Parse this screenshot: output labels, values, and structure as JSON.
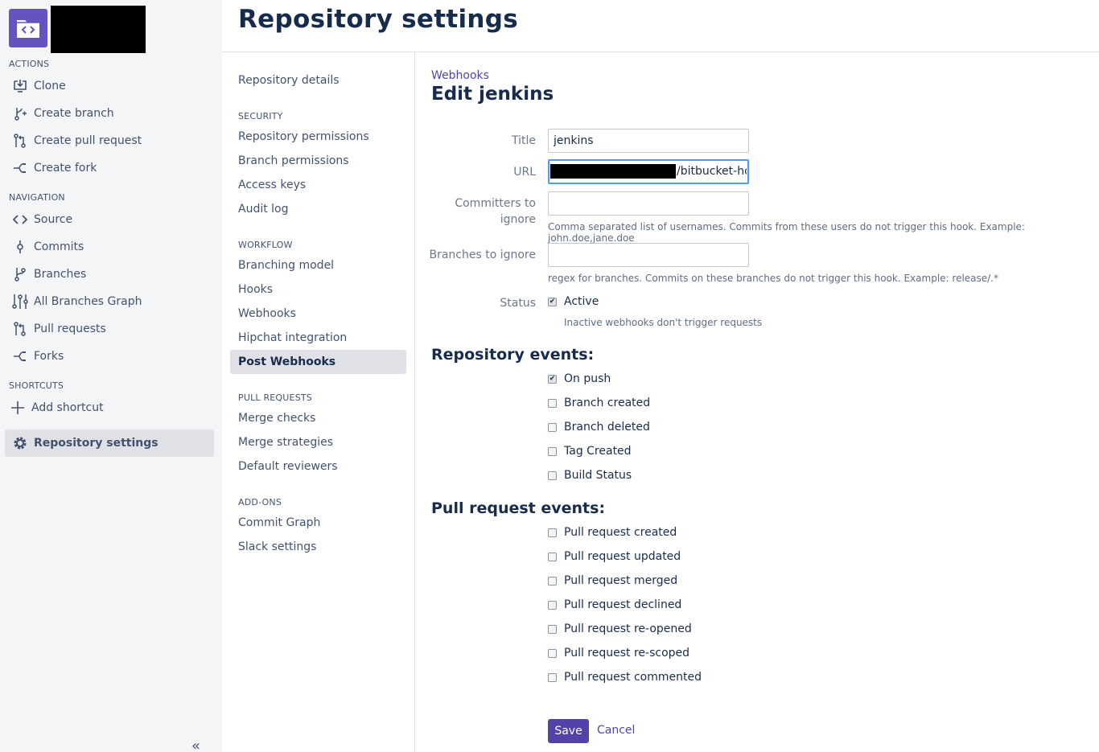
{
  "sidebar": {
    "sections": {
      "actions": "ACTIONS",
      "navigation": "NAVIGATION",
      "shortcuts": "SHORTCUTS"
    },
    "actions": [
      {
        "label": "Clone",
        "icon": "clone-icon"
      },
      {
        "label": "Create branch",
        "icon": "create-branch-icon"
      },
      {
        "label": "Create pull request",
        "icon": "create-pull-request-icon"
      },
      {
        "label": "Create fork",
        "icon": "create-fork-icon"
      }
    ],
    "navigation": [
      {
        "label": "Source",
        "icon": "source-icon"
      },
      {
        "label": "Commits",
        "icon": "commits-icon"
      },
      {
        "label": "Branches",
        "icon": "branches-icon"
      },
      {
        "label": "All Branches Graph",
        "icon": "all-branches-graph-icon"
      },
      {
        "label": "Pull requests",
        "icon": "pull-requests-icon"
      },
      {
        "label": "Forks",
        "icon": "forks-icon"
      }
    ],
    "shortcuts": [
      {
        "label": "Add shortcut",
        "icon": "plus-icon"
      }
    ],
    "settings": {
      "label": "Repository settings",
      "icon": "gear-icon"
    }
  },
  "page": {
    "title": "Repository settings"
  },
  "settings_nav": {
    "repository_details": "Repository details",
    "security": {
      "heading": "SECURITY",
      "items": [
        "Repository permissions",
        "Branch permissions",
        "Access keys",
        "Audit log"
      ]
    },
    "workflow": {
      "heading": "WORKFLOW",
      "items": [
        "Branching model",
        "Hooks",
        "Webhooks",
        "Hipchat integration",
        "Post Webhooks"
      ]
    },
    "pull_requests": {
      "heading": "PULL REQUESTS",
      "items": [
        "Merge checks",
        "Merge strategies",
        "Default reviewers"
      ]
    },
    "add_ons": {
      "heading": "ADD-ONS",
      "items": [
        "Commit Graph",
        "Slack settings"
      ]
    }
  },
  "form": {
    "breadcrumb": "Webhooks",
    "title": "Edit jenkins",
    "title_label": "Title",
    "title_value": "jenkins",
    "url_label": "URL",
    "url_visible": "/bitbucket-hook/",
    "committers_label_1": "Committers to",
    "committers_label_2": "ignore",
    "committers_value": "",
    "committers_help": "Comma separated list of usernames. Commits from these users do not trigger this hook. Example: john.doe,jane.doe",
    "branches_label": "Branches to ignore",
    "branches_value": "",
    "branches_help": "regex for branches. Commits on these branches do not trigger this hook. Example: release/.*",
    "status_label": "Status",
    "active_label": "Active",
    "active_checked": true,
    "active_help": "Inactive webhooks don't trigger requests",
    "repo_events_heading": "Repository events:",
    "repo_events": [
      {
        "label": "On push",
        "checked": true
      },
      {
        "label": "Branch created",
        "checked": false
      },
      {
        "label": "Branch deleted",
        "checked": false
      },
      {
        "label": "Tag Created",
        "checked": false
      },
      {
        "label": "Build Status",
        "checked": false
      }
    ],
    "pr_events_heading": "Pull request events:",
    "pr_events": [
      {
        "label": "Pull request created",
        "checked": false
      },
      {
        "label": "Pull request updated",
        "checked": false
      },
      {
        "label": "Pull request merged",
        "checked": false
      },
      {
        "label": "Pull request declined",
        "checked": false
      },
      {
        "label": "Pull request re-opened",
        "checked": false
      },
      {
        "label": "Pull request re-scoped",
        "checked": false
      },
      {
        "label": "Pull request commented",
        "checked": false
      }
    ],
    "save_label": "Save",
    "cancel_label": "Cancel"
  },
  "colors": {
    "accent": "#5243aa",
    "avatar": "#6554c0",
    "sidebar_bg": "#f4f5f7"
  }
}
